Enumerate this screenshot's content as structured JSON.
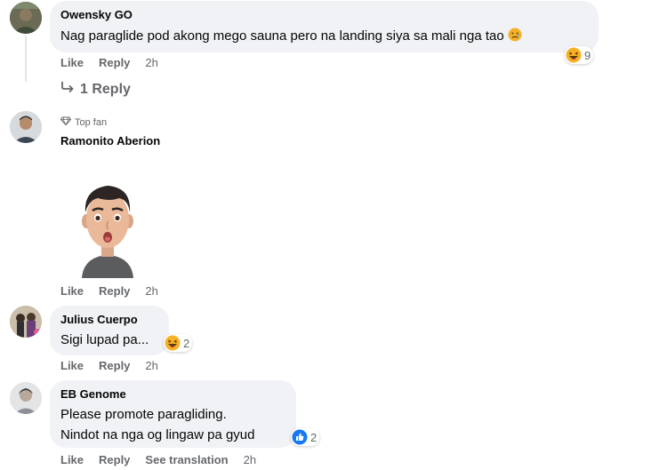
{
  "comments": [
    {
      "author": "Owensky GO",
      "text": "Nag paraglide pod akong mego sauna pero na landing siya sa mali nga tao",
      "actions": {
        "like": "Like",
        "reply": "Reply",
        "time": "2h"
      },
      "reactions": {
        "icon": "haha-emoji-icon",
        "count": "9"
      },
      "replies_label": "1 Reply"
    },
    {
      "badge": "Top fan",
      "author": "Ramonito Aberion",
      "sticker": "avatar-sticker",
      "actions": {
        "like": "Like",
        "reply": "Reply",
        "time": "2h"
      }
    },
    {
      "author": "Julius Cuerpo",
      "text": "Sigi lupad pa...",
      "actions": {
        "like": "Like",
        "reply": "Reply",
        "time": "2h"
      },
      "reactions": {
        "icon": "haha-emoji-icon",
        "count": "2"
      }
    },
    {
      "author": "EB Genome",
      "text_line1": "Please promote paragliding.",
      "text_line2": "Nindot na nga og lingaw pa gyud",
      "actions": {
        "like": "Like",
        "reply": "Reply",
        "see_translation": "See translation",
        "time": "2h"
      },
      "reactions": {
        "icon": "like-icon",
        "count": "2"
      }
    }
  ],
  "colors": {
    "bubble": "#f0f2f5",
    "meta": "#65676b",
    "like_blue": "#1877f2",
    "haha_yellow": "#f7b125"
  }
}
